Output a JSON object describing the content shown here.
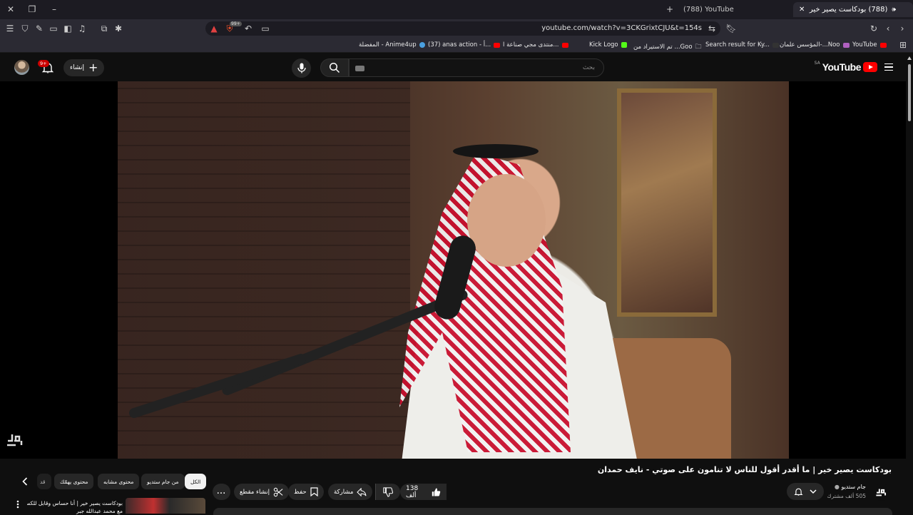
{
  "browser": {
    "tabs": [
      {
        "label": "(788) YouTube"
      },
      {
        "label": "(788) بودكاست يصير خير | ما أ..."
      }
    ],
    "url": "youtube.com/watch?v=3CKGrixtCJU&t=154s",
    "ext_badge": "99+",
    "bookmarks": [
      {
        "label": "YouTube"
      },
      {
        "label": "المؤسس علمان-...Noo"
      },
      {
        "label": "Search result for Ky..."
      },
      {
        "label": "تم الاستيراد من ...Goo"
      },
      {
        "label": "Kick Logo"
      },
      {
        "label": "منتدى مجي صناعة ا..."
      },
      {
        "label": "(37) anas action - أ..."
      },
      {
        "label": "المفضلة - Anime4up"
      }
    ]
  },
  "youtube": {
    "logo_text": "YouTube",
    "region": "SA",
    "search_placeholder": "بحث",
    "create_label": "إنشاء",
    "notif_badge": "9+",
    "video": {
      "title": "بودكاست يصير خير | ما أقدر أقول للناس لا تنامون على صوتي - نايف حمدان",
      "channel": "جام ستديو",
      "subscribers": "505 ألف مشترك",
      "likes": "138 ألف",
      "share_label": "مشاركة",
      "save_label": "حفظ",
      "clip_label": "إنشاء مقطع",
      "more_label": "..."
    },
    "chips": [
      {
        "label": "الكل",
        "selected": true
      },
      {
        "label": "من جام ستديو",
        "selected": false
      },
      {
        "label": "محتوى مشابه",
        "selected": false
      },
      {
        "label": "محتوى يهمّك",
        "selected": false
      },
      {
        "label": "قد",
        "selected": false
      }
    ],
    "recommendation": {
      "title": "بودكاست يصير خير | أنا حساس وقابل للكسر",
      "subtitle": "مع محمد عبدالله جبر"
    },
    "watermark": "جام"
  },
  "colors": {
    "brand_red": "#ff0000",
    "background": "#0f0f0f",
    "pill": "#272727",
    "browser_chrome": "#2b2a33"
  }
}
